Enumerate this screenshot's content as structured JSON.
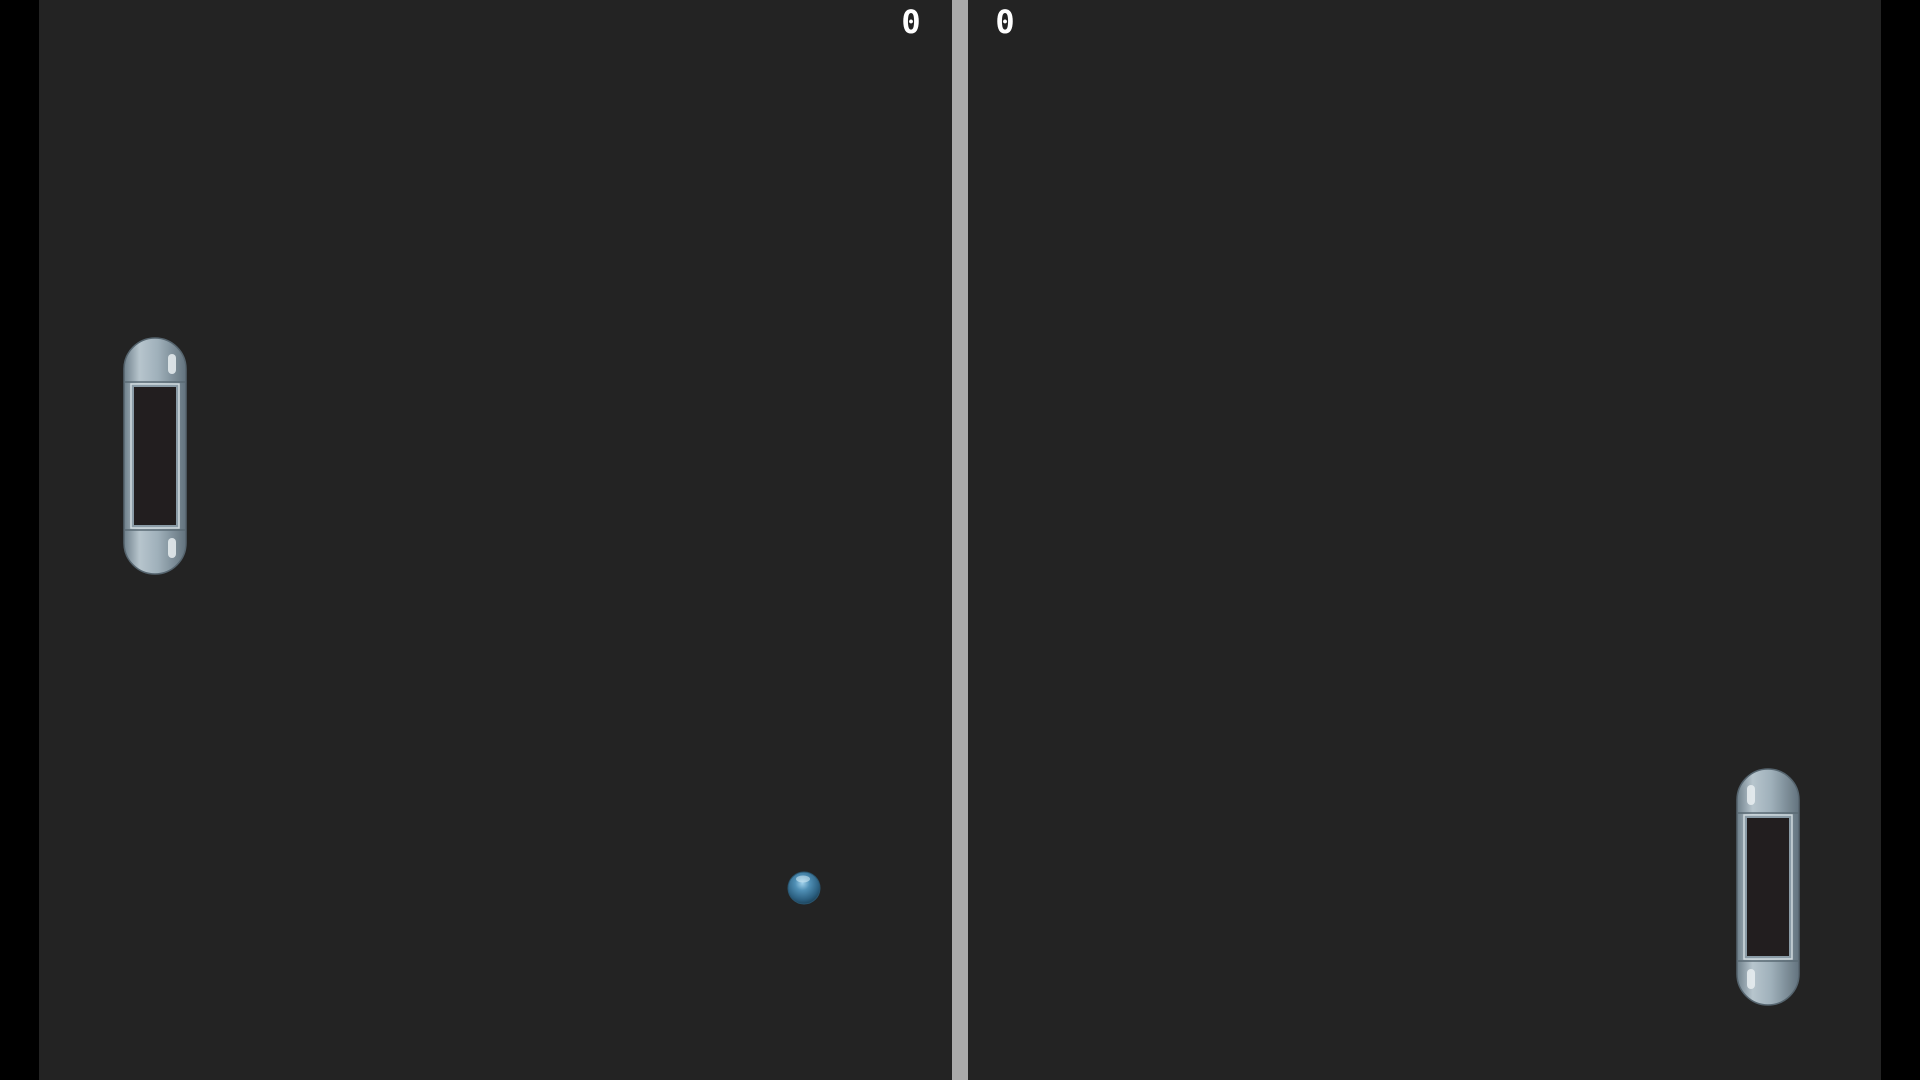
{
  "game": {
    "scores": {
      "left": "0",
      "right": "0"
    }
  },
  "colors": {
    "background": "#000000",
    "court": "#232323",
    "net": "#a9a9a9",
    "score_text": "#ffffff",
    "paddle_body": "#9aaab4",
    "paddle_window": "#221e1f",
    "ball": "#3f7fa6"
  },
  "icons": {
    "left_paddle": "metal-capsule-paddle",
    "right_paddle": "metal-capsule-paddle",
    "ball": "glossy-blue-sphere"
  }
}
